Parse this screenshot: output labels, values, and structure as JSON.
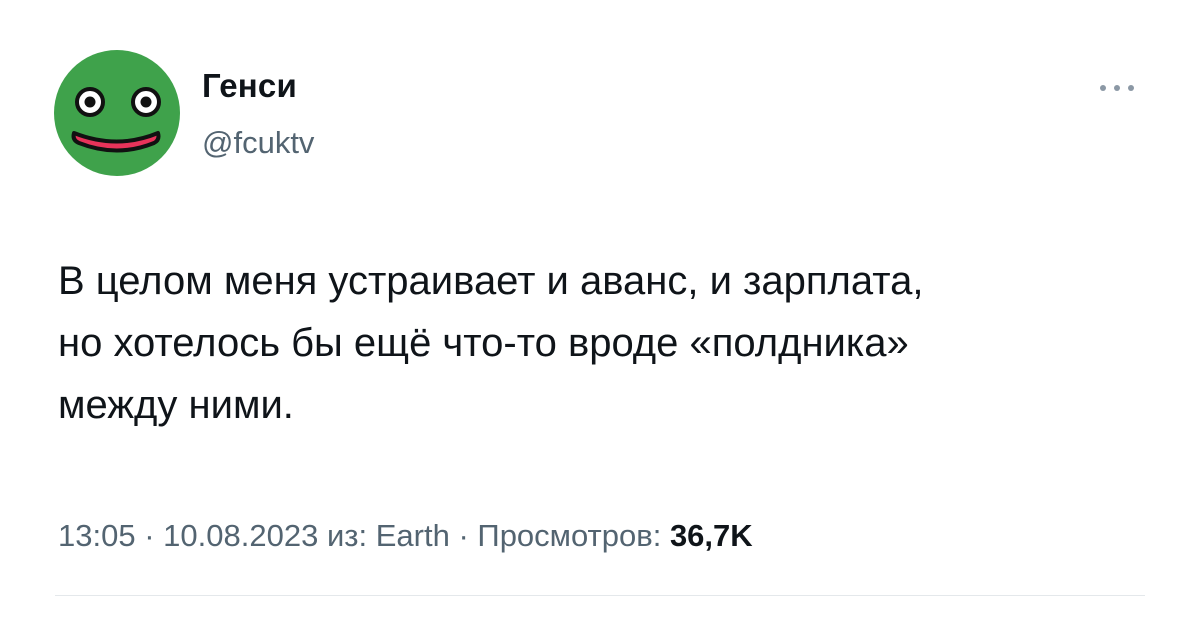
{
  "author": {
    "name": "Генси",
    "handle": "@fcuktv",
    "avatar": {
      "icon": "frog-face-icon",
      "background_color": "#3fa24b",
      "mouth_color": "#e8335a"
    }
  },
  "more_button": {
    "icon": "more-dots-icon"
  },
  "tweet": {
    "text_lines": [
      "В целом меня устраивает и аванс, и зарплата,",
      "но хотелось бы ещё что-то вроде «полдника»",
      "между ними."
    ]
  },
  "meta": {
    "time": "13:05",
    "separator": "·",
    "date": "10.08.2023",
    "source_prefix": "из:",
    "source": "Earth",
    "views_label": "Просмотров:",
    "views_count": "36,7K"
  },
  "colors": {
    "text_primary": "#0f1419",
    "text_secondary": "#536471",
    "divider": "#e4e8eb"
  }
}
